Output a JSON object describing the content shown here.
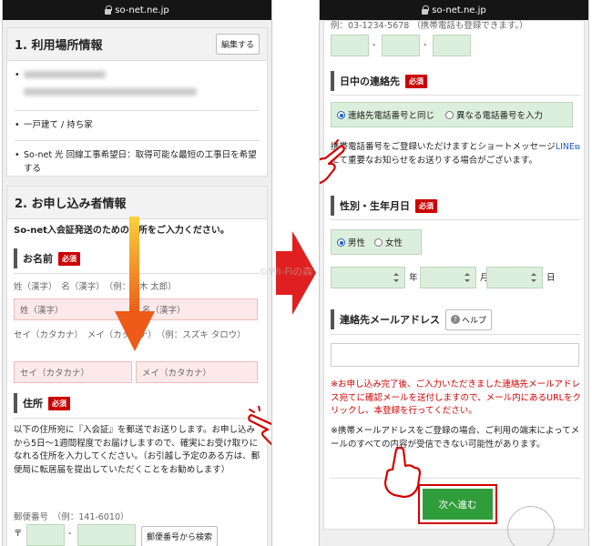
{
  "left": {
    "url": "so-net.ne.jp",
    "section1": {
      "title": "1. 利用場所情報",
      "edit_button": "編集する",
      "items": [
        "一戸建て / 持ち家",
        "So-net 光 回線工事希望日：取得可能な最短の工事日を希望する"
      ]
    },
    "section2": {
      "title": "2. お申し込み者情報",
      "intro": "So-net入会証発送のための住所をご入力ください。",
      "name_title": "お名前",
      "required": "必須",
      "kanji_label": "姓（漢字）　名（漢字）　（例：鈴木 太郎）",
      "sei_kanji_placeholder": "姓（漢字）",
      "mei_kanji_placeholder": "名（漢字）",
      "kana_label": "セイ（カタカナ）　メイ（カタカナ）　（例：スズキ タロウ）",
      "sei_kana_placeholder": "セイ（カタカナ）",
      "mei_kana_placeholder": "メイ（カタカナ）",
      "address_title": "住所",
      "address_desc": "以下の住所宛に『入会証』を郵送でお送りします。お申し込みから5日〜1週間程度でお届けしますので、確実にお受け取りになれる住所を入力してください。（お引越し予定のある方は、郵便局に転居届を提出していただくことをお勧めします）",
      "postal_label": "郵便番号　（例：141-6010）",
      "postal_mark": "〒",
      "postal_dash": "-",
      "postal_search_button": "郵便番号から検索"
    }
  },
  "right": {
    "url": "so-net.ne.jp",
    "phone_example": "例：03-1234-5678 （携帯電話も登録できます。）",
    "phone_dash": "-",
    "daytime_title": "日中の連絡先",
    "required": "必須",
    "radio_same": "連絡先電話番号と同じ",
    "radio_diff": "異なる電話番号を入力",
    "sms_note_1": "携帯電話番号をご登録いただけますとショートメッセージ",
    "sms_link": "LINE",
    "sms_note_2": "にて重要なお知らせをお送りする場合がございます。",
    "gender_title": "性別・生年月日",
    "male": "男性",
    "female": "女性",
    "year": "年",
    "month": "月",
    "day": "日",
    "email_title": "連絡先メールアドレス",
    "help_button": "ヘルプ",
    "email_note_red": "※お申し込み完了後、ご入力いただきました連絡先メールアドレス宛てに確認メールを送付しますので、メール内にあるURLをクリックし、本登録を行ってください。",
    "email_note_black": "※携帯メールアドレスをご登録の場合、ご利用の端末によってメールのすべての内容が受信できない可能性があります。",
    "next_button": "次へ進む"
  },
  "watermark": "©Wi-Fiの森",
  "colors": {
    "required_red": "#cc0000",
    "next_green": "#2f9e3a",
    "highlight_red": "#d40000",
    "field_pink": "#fde9ea",
    "field_green": "#dcefdc"
  }
}
